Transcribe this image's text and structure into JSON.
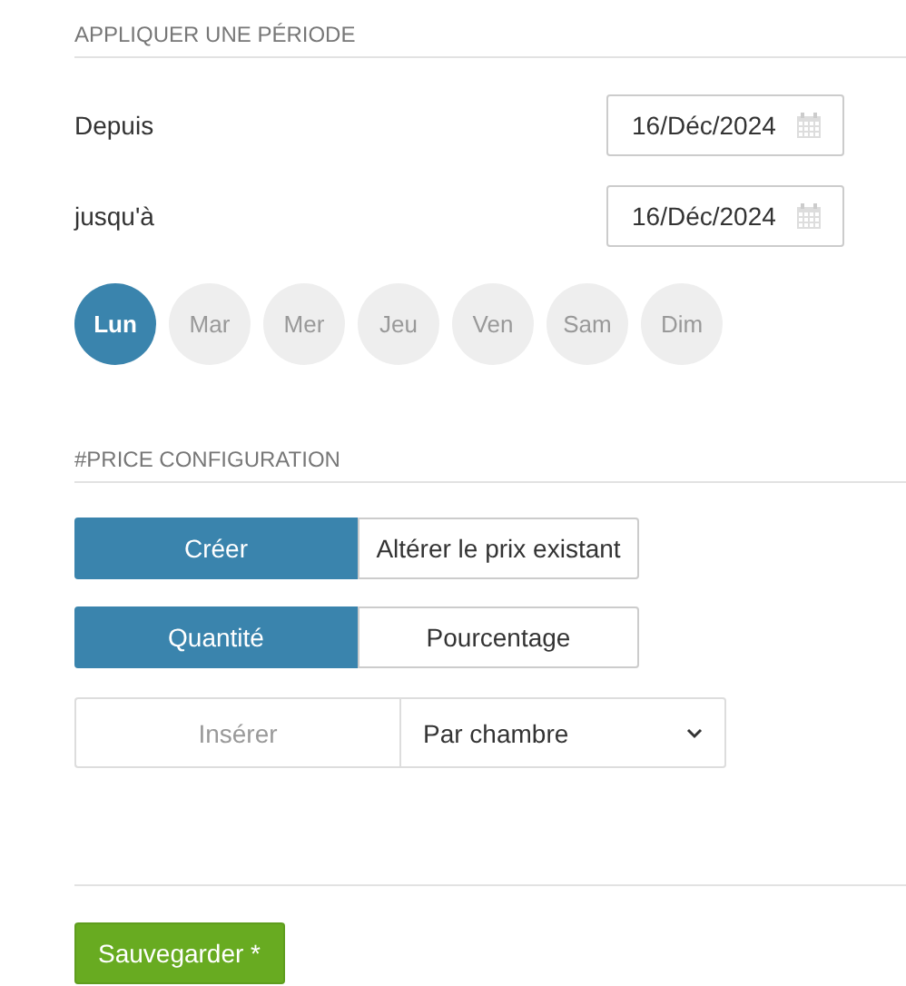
{
  "period": {
    "heading": "APPLIQUER UNE PÉRIODE",
    "dates": [
      {
        "label": "Depuis",
        "value": "16/Déc/2024"
      },
      {
        "label": "jusqu'à",
        "value": "16/Déc/2024"
      }
    ],
    "days": [
      {
        "label": "Lun",
        "selected": true
      },
      {
        "label": "Mar",
        "selected": false
      },
      {
        "label": "Mer",
        "selected": false
      },
      {
        "label": "Jeu",
        "selected": false
      },
      {
        "label": "Ven",
        "selected": false
      },
      {
        "label": "Sam",
        "selected": false
      },
      {
        "label": "Dim",
        "selected": false
      }
    ]
  },
  "price": {
    "heading": "#PRICE CONFIGURATION",
    "toggles": [
      [
        {
          "label": "Créer",
          "selected": true
        },
        {
          "label": "Altérer le prix existant",
          "selected": false
        }
      ],
      [
        {
          "label": "Quantité",
          "selected": true
        },
        {
          "label": "Pourcentage",
          "selected": false
        }
      ]
    ],
    "amount": {
      "placeholder": "Insérer"
    },
    "unit": {
      "value": "Par chambre"
    }
  },
  "save_button": "Sauvegarder *"
}
